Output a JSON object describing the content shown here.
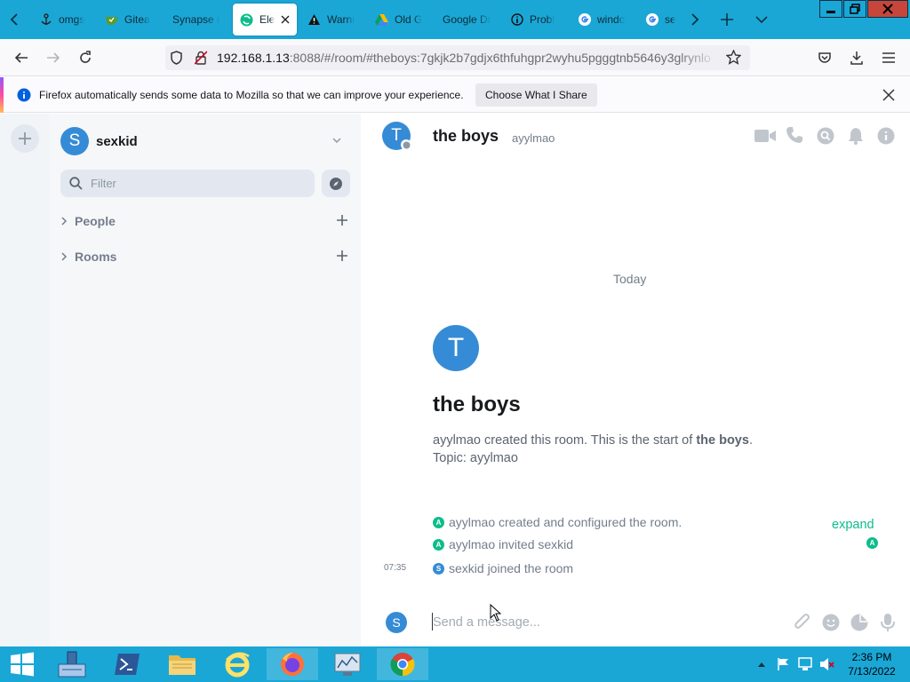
{
  "browser": {
    "tabs": [
      {
        "title": "omgs",
        "icon": "anchor-icon"
      },
      {
        "title": "Gitea",
        "icon": "gitea-tea-icon"
      },
      {
        "title": "Synapse is",
        "icon": "none"
      },
      {
        "title": "Ele",
        "icon": "element-icon"
      },
      {
        "title": "Warni",
        "icon": "warning-icon"
      },
      {
        "title": "Old G",
        "icon": "google-drive-icon"
      },
      {
        "title": "Google Dr",
        "icon": "none"
      },
      {
        "title": "Probl",
        "icon": "info-icon"
      },
      {
        "title": "windo",
        "icon": "google-icon"
      },
      {
        "title": "serv",
        "icon": "google-icon"
      }
    ],
    "url_host": "192.168.1.13",
    "url_rest": ":8088/#/room/#theboys:7gkjk2b7gdjx6thfuhgpr2wyhu5pgggtnb5646y3glrynlo",
    "notification": {
      "message": "Firefox automatically sends some data to Mozilla so that we can improve your experience.",
      "button": "Choose What I Share"
    }
  },
  "element": {
    "user": {
      "initial": "S",
      "name": "sexkid"
    },
    "filter_placeholder": "Filter",
    "sections": [
      {
        "label": "People"
      },
      {
        "label": "Rooms"
      }
    ],
    "room": {
      "initial": "T",
      "name": "the boys",
      "topic": "ayylmao",
      "date_separator": "Today",
      "intro_creator": "ayylmao",
      "intro_created_text": " created this room. This is the start of ",
      "intro_room_bold": "the boys",
      "intro_period": ".",
      "intro_topic": "Topic: ayylmao",
      "events": [
        {
          "avatar": "A",
          "text": "ayylmao created and configured the room."
        },
        {
          "avatar": "A",
          "text": "ayylmao invited sexkid"
        },
        {
          "avatar": "S",
          "text": "sexkid joined the room",
          "time": "07:35"
        }
      ],
      "expand_label": "expand",
      "composer_placeholder": "Send a message..."
    },
    "colors": {
      "accent": "#0dbd8b",
      "avatar_blue": "#368bd6"
    }
  },
  "taskbar": {
    "time": "2:36 PM",
    "date": "7/13/2022"
  }
}
